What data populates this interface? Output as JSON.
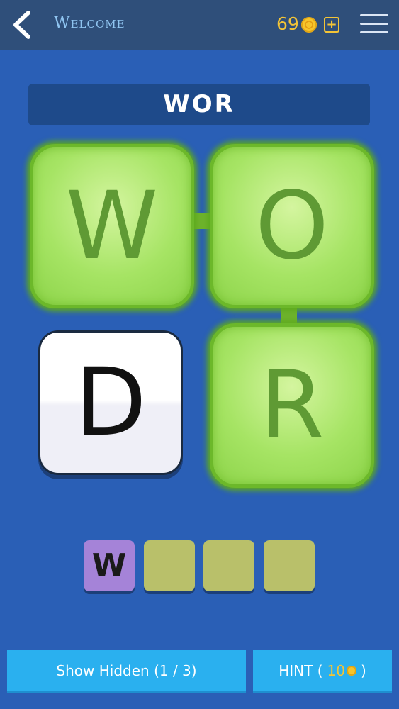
{
  "header": {
    "title": "Welcome",
    "coins": "69"
  },
  "puzzle": {
    "current_word": "WOR",
    "tiles": [
      {
        "letter": "W",
        "state": "selected"
      },
      {
        "letter": "O",
        "state": "selected"
      },
      {
        "letter": "D",
        "state": "unselected"
      },
      {
        "letter": "R",
        "state": "selected"
      }
    ],
    "answer_slots": [
      "W",
      "",
      "",
      ""
    ]
  },
  "actions": {
    "show_hidden_label": "Show Hidden (1 / 3)",
    "hint_label": "HINT (",
    "hint_cost": "10",
    "hint_close": ")"
  },
  "colors": {
    "background": "#2a5fb6",
    "header": "#2f4f7a",
    "selected_tile": "#a6e464",
    "button": "#2ab0ef",
    "coin": "#f6c52b",
    "filled_slot": "#a583d8",
    "empty_slot": "#b9c06a"
  },
  "icons": [
    "back-icon",
    "coin-icon",
    "add-coins-icon",
    "menu-icon"
  ]
}
